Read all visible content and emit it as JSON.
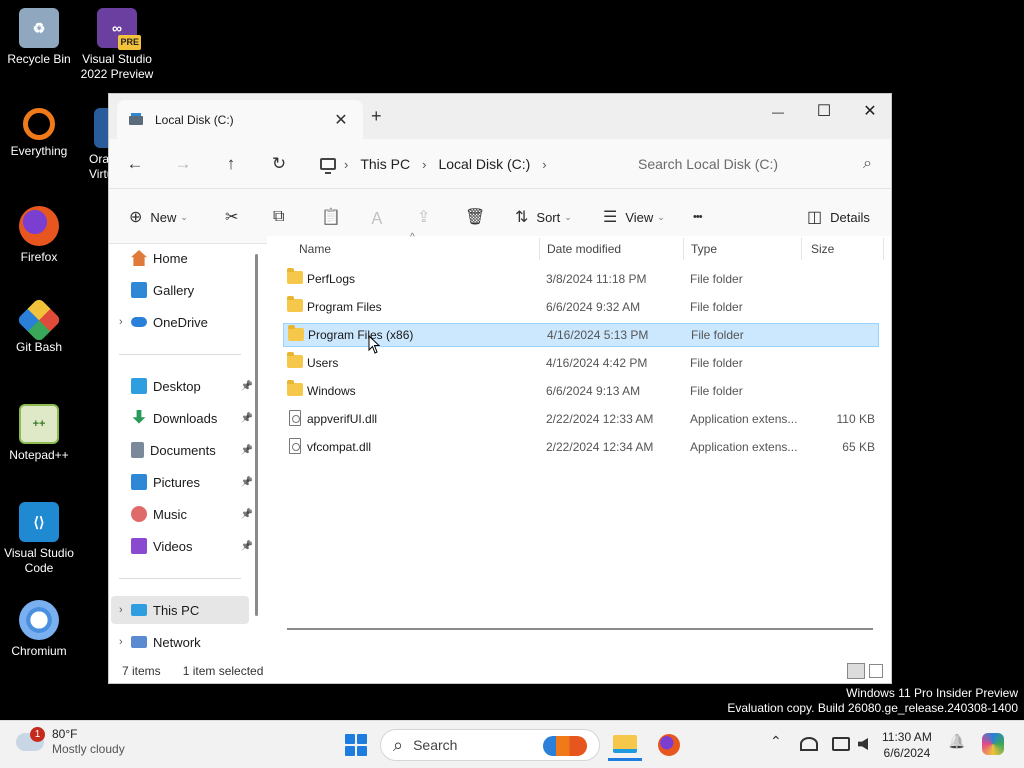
{
  "desktop": {
    "icons": [
      {
        "label": "Recycle Bin",
        "color": "#8fa8c0"
      },
      {
        "label": "Visual Studio 2022 Preview",
        "color": "#6b3fa0",
        "badge": "PRE"
      },
      {
        "label": "Everything",
        "color": "#f07a1a"
      },
      {
        "label": "Orac Virtu",
        "color": "#2a5b9a"
      },
      {
        "label": "Firefox",
        "color": "#e8561f"
      },
      {
        "label": "Git Bash",
        "color": "#3aa65a"
      },
      {
        "label": "Notepad++",
        "color": "#8bbb4e"
      },
      {
        "label": "Visual Studio Code",
        "color": "#1f8ad2"
      },
      {
        "label": "Chromium",
        "color": "#4a8fe0"
      }
    ]
  },
  "window": {
    "tab_title": "Local Disk (C:)",
    "tab_close": "✕",
    "new_tab": "+",
    "controls": {
      "minimize": "—",
      "maximize": "☐",
      "close": "✕"
    }
  },
  "address": {
    "back": "←",
    "forward": "→",
    "up": "↑",
    "refresh": "↻",
    "breadcrumb": [
      "This PC",
      "Local Disk (C:)"
    ],
    "chevron": "›",
    "search_placeholder": "Search Local Disk (C:)",
    "search_icon": "⌕"
  },
  "toolbar": {
    "new_label": "New",
    "new_icon": "⊕",
    "cut_icon": "✂",
    "copy_icon": "⧉",
    "paste_icon": "📋",
    "rename_icon": "Ａ",
    "share_icon": "⇪",
    "delete_icon": "🗑",
    "sort_label": "Sort",
    "sort_icon": "⇅",
    "view_label": "View",
    "view_icon": "☰",
    "more_icon": "•••",
    "details_label": "Details",
    "details_icon": "◫",
    "caret": "⌄"
  },
  "sidebar": {
    "items": [
      {
        "label": "Home",
        "color": "#e07a3a"
      },
      {
        "label": "Gallery",
        "color": "#2f88d6"
      },
      {
        "label": "OneDrive",
        "color": "#2a7fd8",
        "expander": "›"
      },
      {
        "label": "Desktop",
        "color": "#2f9ee0",
        "pin": "📌"
      },
      {
        "label": "Downloads",
        "color": "#2a9a5a",
        "pin": "📌"
      },
      {
        "label": "Documents",
        "color": "#7a8a9a",
        "pin": "📌"
      },
      {
        "label": "Pictures",
        "color": "#2f88d6",
        "pin": "📌"
      },
      {
        "label": "Music",
        "color": "#e06a6a",
        "pin": "📌"
      },
      {
        "label": "Videos",
        "color": "#8a4ad0",
        "pin": "📌"
      },
      {
        "label": "This PC",
        "color": "#2f9ee0",
        "expander": "›"
      },
      {
        "label": "Network",
        "color": "#5a8ad0",
        "expander": "›"
      }
    ]
  },
  "filelist": {
    "sort_indicator": "^",
    "columns": {
      "name": "Name",
      "date": "Date modified",
      "type": "Type",
      "size": "Size"
    },
    "rows": [
      {
        "name": "PerfLogs",
        "date": "3/8/2024 11:18 PM",
        "type": "File folder",
        "size": "",
        "kind": "folder"
      },
      {
        "name": "Program Files",
        "date": "6/6/2024 9:32 AM",
        "type": "File folder",
        "size": "",
        "kind": "folder"
      },
      {
        "name": "Program Files (x86)",
        "date": "4/16/2024 5:13 PM",
        "type": "File folder",
        "size": "",
        "kind": "folder",
        "selected": true
      },
      {
        "name": "Users",
        "date": "4/16/2024 4:42 PM",
        "type": "File folder",
        "size": "",
        "kind": "folder"
      },
      {
        "name": "Windows",
        "date": "6/6/2024 9:13 AM",
        "type": "File folder",
        "size": "",
        "kind": "folder"
      },
      {
        "name": "appverifUI.dll",
        "date": "2/22/2024 12:33 AM",
        "type": "Application extens...",
        "size": "110 KB",
        "kind": "file"
      },
      {
        "name": "vfcompat.dll",
        "date": "2/22/2024 12:34 AM",
        "type": "Application extens...",
        "size": "65 KB",
        "kind": "file"
      }
    ]
  },
  "status": {
    "count": "7 items",
    "selection": "1 item selected"
  },
  "watermark": {
    "line1": "Windows 11 Pro Insider Preview",
    "line2": "Evaluation copy. Build 26080.ge_release.240308-1400"
  },
  "taskbar": {
    "weather_temp": "80°F",
    "weather_desc": "Mostly cloudy",
    "weather_badge": "1",
    "search_label": "Search",
    "search_icon": "⌕",
    "tray_chevron": "⌃",
    "time": "11:30 AM",
    "date": "6/6/2024",
    "bell_icon": "🔔"
  }
}
